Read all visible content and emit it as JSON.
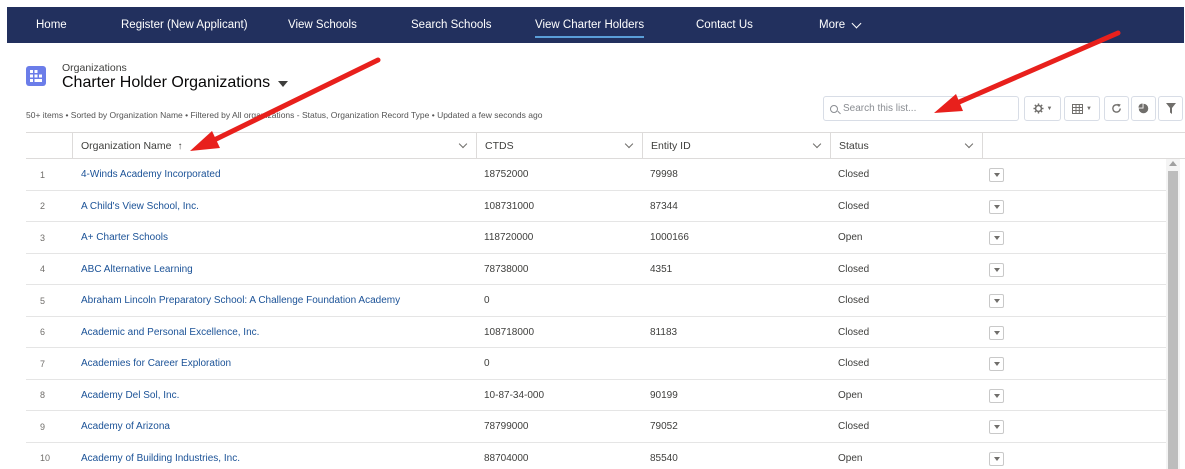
{
  "nav": {
    "items": [
      {
        "label": "Home"
      },
      {
        "label": "Register (New Applicant)"
      },
      {
        "label": "View Schools"
      },
      {
        "label": "Search Schools"
      },
      {
        "label": "View Charter Holders"
      },
      {
        "label": "Contact Us"
      },
      {
        "label": "More"
      }
    ],
    "active_index": 4
  },
  "header": {
    "object_label": "Organizations",
    "list_title": "Charter Holder Organizations",
    "meta": "50+ items • Sorted by Organization Name • Filtered by All organizations - Status, Organization Record Type • Updated a few seconds ago",
    "icon": "organization-grid-icon"
  },
  "search": {
    "placeholder": "Search this list..."
  },
  "toolbar": {
    "icons": [
      "gear-icon",
      "table-view-icon",
      "refresh-icon",
      "chart-icon",
      "filter-icon"
    ]
  },
  "table": {
    "columns": [
      "Organization Name",
      "CTDS",
      "Entity ID",
      "Status"
    ],
    "sort_indicator": "↑",
    "rows": [
      {
        "num": "1",
        "name": "4-Winds Academy Incorporated",
        "ctds": "18752000",
        "entity": "79998",
        "status": "Closed"
      },
      {
        "num": "2",
        "name": "A Child's View School, Inc.",
        "ctds": "108731000",
        "entity": "87344",
        "status": "Closed"
      },
      {
        "num": "3",
        "name": "A+ Charter Schools",
        "ctds": "118720000",
        "entity": "1000166",
        "status": "Open"
      },
      {
        "num": "4",
        "name": "ABC Alternative Learning",
        "ctds": "78738000",
        "entity": "4351",
        "status": "Closed"
      },
      {
        "num": "5",
        "name": "Abraham Lincoln Preparatory School: A Challenge Foundation Academy",
        "ctds": "0",
        "entity": "",
        "status": "Closed"
      },
      {
        "num": "6",
        "name": "Academic and Personal Excellence, Inc.",
        "ctds": "108718000",
        "entity": "81183",
        "status": "Closed"
      },
      {
        "num": "7",
        "name": "Academies for Career Exploration",
        "ctds": "0",
        "entity": "",
        "status": "Closed"
      },
      {
        "num": "8",
        "name": "Academy Del Sol, Inc.",
        "ctds": "10-87-34-000",
        "entity": "90199",
        "status": "Open"
      },
      {
        "num": "9",
        "name": "Academy of Arizona",
        "ctds": "78799000",
        "entity": "79052",
        "status": "Closed"
      },
      {
        "num": "10",
        "name": "Academy of Building Industries, Inc.",
        "ctds": "88704000",
        "entity": "85540",
        "status": "Open"
      }
    ]
  },
  "colors": {
    "nav_bg": "#22305e",
    "link": "#1b5297",
    "object_icon": "#6b7de9",
    "annotation_arrow": "#e8201c"
  }
}
